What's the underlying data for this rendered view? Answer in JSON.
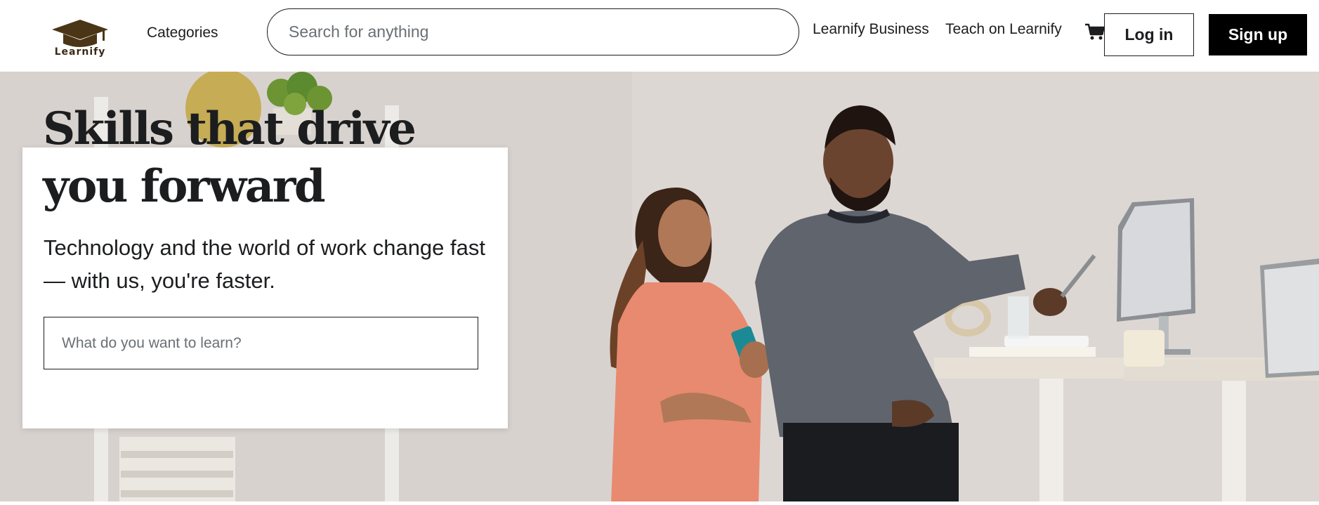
{
  "brand": {
    "name": "Learnify",
    "logo_color": "#4a3516"
  },
  "header": {
    "categories_label": "Categories",
    "search_placeholder": "Search for anything",
    "business_link": "Learnify Business",
    "teach_link": "Teach on Learnify",
    "cart_icon": "cart-icon",
    "login_label": "Log in",
    "signup_label": "Sign up"
  },
  "hero": {
    "headline": "Skills that drive you forward",
    "subtext": "Technology and the world of work change fast — with us, you're faster.",
    "search_placeholder": "What do you want to learn?"
  },
  "colors": {
    "text": "#1c1d1f",
    "signup_bg": "#000000",
    "hero_bg": "#ddd7d4"
  }
}
